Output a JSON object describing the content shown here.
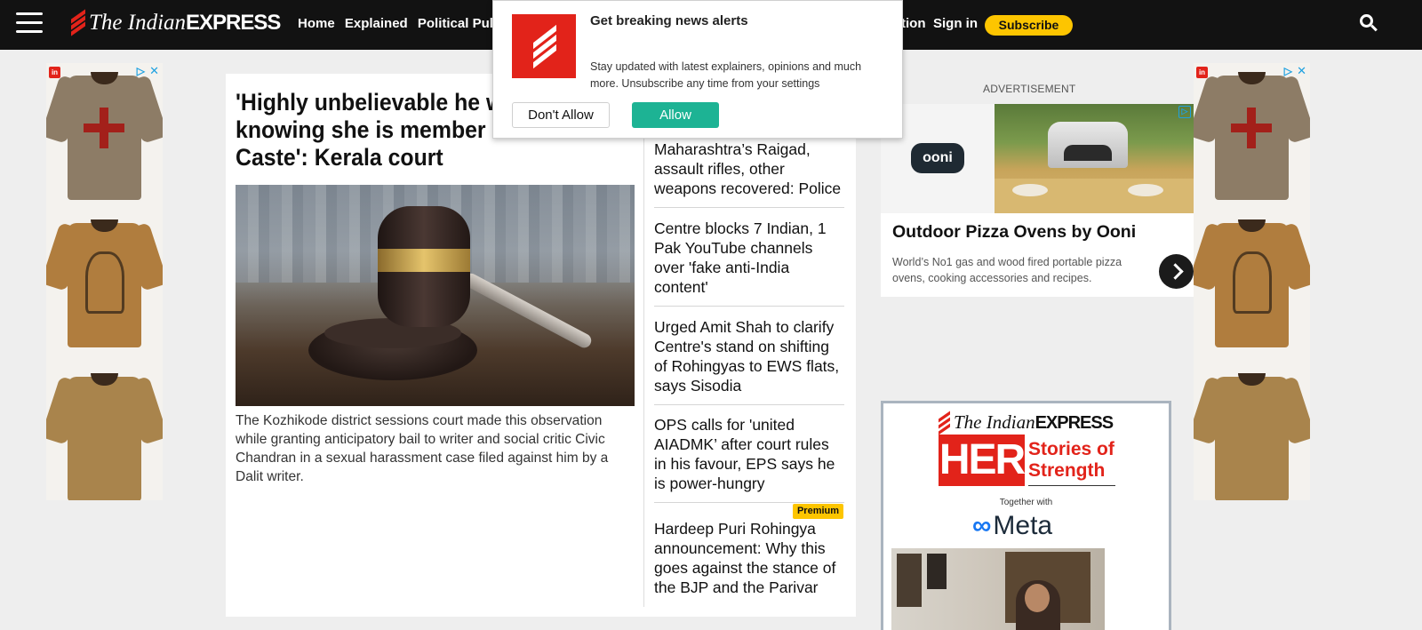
{
  "header": {
    "logo_the": "The Indian",
    "logo_express": "EXPRESS",
    "nav": [
      "Home",
      "Explained",
      "Political Pulse"
    ],
    "nav_right_fragment": "tion",
    "signin": "Sign in",
    "subscribe": "Subscribe"
  },
  "notification": {
    "title": "Get breaking news alerts",
    "text": "Stay updated with latest explainers, opinions and much more. Unsubscribe any time from your settings",
    "deny": "Don't Allow",
    "allow": "Allow"
  },
  "article": {
    "headline": "'Highly unbelievable he wi… knowing she is member o… Caste': Kerala court",
    "headline_lines": [
      "'Highly unbelievable he wi",
      "knowing she is member o",
      "Caste': Kerala court"
    ],
    "summary": "The Kozhikode district sessions court made this observation while granting anticipatory bail to writer and social critic Civic Chandran in a sexual harassment case filed against him by a Dalit writer."
  },
  "stories": [
    {
      "title": "Maharashtra’s Raigad, assault rifles, other weapons recovered: Police"
    },
    {
      "title": "Centre blocks 7 Indian, 1 Pak YouTube channels over 'fake anti-India content'"
    },
    {
      "title": "Urged Amit Shah to clarify Centre's stand on shifting of Rohingyas to EWS flats, says Sisodia"
    },
    {
      "title": "OPS calls for 'united AIADMK’ after court rules in his favour, EPS says he is power-hungry"
    },
    {
      "title": "Hardeep Puri Rohingya announcement: Why this goes against the stance of the BJP and the Parivar",
      "badge": "Premium"
    }
  ],
  "ads": {
    "label": "ADVERTISEMENT",
    "side_badge": "in",
    "ooni": {
      "logo": "ooni",
      "title": "Outdoor Pizza Ovens by Ooni",
      "description": "World’s No1 gas and wood fired portable pizza ovens, cooking accessories and recipes."
    },
    "her": {
      "logo_the": "The Indian",
      "logo_express": "EXPRESS",
      "her": "HER",
      "stories_line1": "Stories of",
      "stories_line2": "Strength",
      "together": "Together with",
      "meta": "Meta"
    }
  },
  "colors": {
    "header_bg": "#121212",
    "brand_red": "#e2231a",
    "subscribe_yellow": "#fdc500",
    "allow_green": "#1db394",
    "premium_yellow": "#fdc500"
  },
  "icons": [
    "hamburger-icon",
    "search-icon",
    "adchoices-icon",
    "close-icon",
    "chevron-right-icon"
  ]
}
